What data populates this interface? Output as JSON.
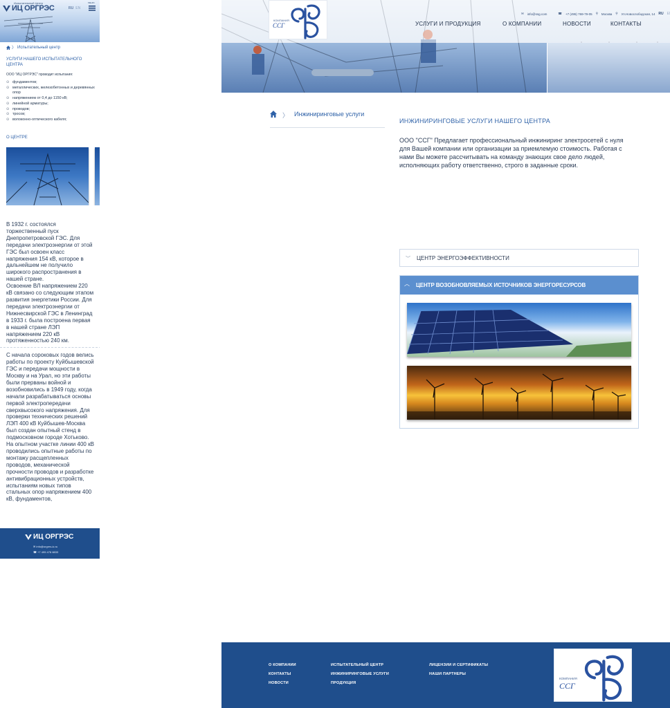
{
  "colors": {
    "brand_blue": "#1f4e8c",
    "accent_blue": "#2f62a8",
    "accordion_active": "#5b8fcf"
  },
  "mobile": {
    "logo_small": "Испытательный Центр",
    "logo": "ИЦ ОРГРЭС",
    "lang_active": "RU",
    "lang_inactive": "EN",
    "menu_label": "МЕНЮ",
    "breadcrumb": "Испытательный центр",
    "services_title": "УСЛУГИ НАШЕГО ИСПЫТАТЕЛЬНОГО ЦЕНТРА",
    "intro": "ООО \"ИЦ ОРГРЭС\" проводит испытания:",
    "list": [
      "фундаментов;",
      "металлических, железобетонных и деревянных опор",
      "напряжением от 0,4 до 1150 кВ;",
      "линейной арматуры;",
      "проводов;",
      "тросов;",
      "волоконно-оптического кабеля;"
    ],
    "about_title": "О ЦЕНТРЕ",
    "history_1": "В 1932 г. состоялся торжественный пуск Днепропетровской ГЭС. Для передачи электроэнергии от этой ГЭС был освоен класс напряжения 154 кВ, которое в дальнейшем не получило широкого распространения в нашей стране.",
    "history_2": "Освоение ВЛ напряжением 220 кВ связано со следующим этапом развития энергетики России. Для передачи электроэнергии от Нижнесвирской ГЭС в Ленинград в 1933 г. была построена первая в нашей стране ЛЭП напряжением 220 кВ протяженностью 240 км.",
    "history_3": "С начала сороковых годов велись работы по проекту Куйбышевской ГЭС и передачи мощности в Москву и на Урал, но эти работы были прерваны войной и возобновились в 1949 году, когда начали разрабатываться основы первой электропередачи сверхвысокого напряжения. Для проверки технических решений ЛЭП 400 кВ Куйбышев-Москва был создан опытный стенд в подмосковном городе Хотьково. На опытном участке линии 400 кВ проводились опытные работы по монтажу расщепленных проводов, механической прочности проводов и разработке антивибрационных устройств, испытаниям новых типов стальных опор напряжением 400 кВ, фундаментов,",
    "footer_logo": "ИЦ ОРГРЭС",
    "footer_email": "info@orgres-ic.ru",
    "footer_phone": "+7 495 478 8833"
  },
  "header": {
    "logo_tagline": "КОМПАНИЯ",
    "logo_abbr": "ССГ",
    "email": "info@ssg.com",
    "phone": "+7 (495) 769-79-05",
    "city": "Москва",
    "address": "Ул.Новослободская, 14",
    "lang_active": "RU",
    "lang_inactive": "EN",
    "nav": {
      "services": "УСЛУГИ И ПРОДУКЦИЯ",
      "about": "О КОМПАНИИ",
      "news": "НОВОСТИ",
      "contacts": "КОНТАКТЫ"
    }
  },
  "breadcrumb": {
    "current": "Инжиниринговые услуги"
  },
  "content": {
    "title": "ИНЖИНИРИНГОВЫЕ УСЛУГИ НАШЕГО ЦЕНТРА",
    "text": "ООО \"ССГ\" Предлагает профессиональный инжиниринг электросетей с нуля для Вашей компании или организации за приемлемую стоимость. Работая с нами Вы можете рассчитывать на команду знающих свое дело людей, исполняющих работу ответственно, строго в заданные сроки."
  },
  "accordion": [
    {
      "label": "ЦЕНТР ЭНЕРГОЭФФЕКТИВНОСТИ",
      "icon": "chevron-down-icon"
    },
    {
      "label": "ЦЕНТР ВОЗОБНОВЛЯЕМЫХ ИСТОЧНИКОВ ЭНЕРГОРЕСУРСОВ",
      "icon": "chevron-up-icon"
    }
  ],
  "footer": {
    "col1": [
      "О КОМПАНИИ",
      "КОНТАКТЫ",
      "НОВОСТИ"
    ],
    "col2": [
      "ИСПЫТАТЕЛЬНЫЙ ЦЕНТР",
      "ИНЖИНИРИНГОВЫЕ УСЛУГИ",
      "ПРОДУКЦИЯ"
    ],
    "col3": [
      "ЛИЦЕНЗИИ И СЕРТИФИКАТЫ",
      "НАШИ ПАРТНЕРЫ"
    ],
    "logo_tagline": "КОМПАНИЯ",
    "logo_abbr": "ССГ"
  }
}
